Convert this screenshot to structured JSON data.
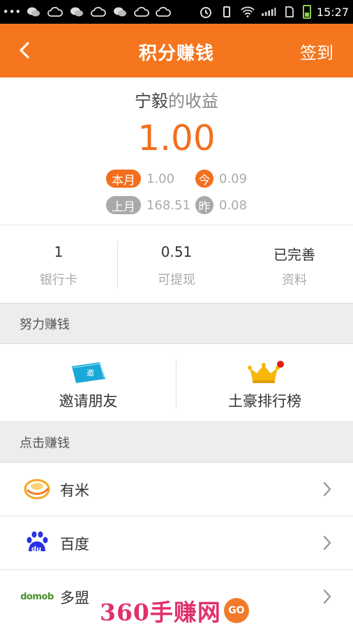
{
  "status_bar": {
    "time": "15:27",
    "left_icons": [
      "more-dots-icon",
      "wechat-icon",
      "cloud-icon",
      "wechat-icon",
      "cloud-icon",
      "wechat-icon",
      "cloud-icon",
      "cloud-icon"
    ],
    "right_icons": [
      "alarm-icon",
      "vibrate-icon",
      "wifi-icon",
      "signal-icon",
      "sim-icon",
      "battery-icon"
    ]
  },
  "header": {
    "title": "积分赚钱",
    "back_icon": "chevron-left-icon",
    "checkin_label": "签到"
  },
  "earnings": {
    "username": "宁毅",
    "title_suffix": "的收益",
    "total": "1.00",
    "this_month_label": "本月",
    "this_month_value": "1.00",
    "today_label": "今",
    "today_value": "0.09",
    "last_month_label": "上月",
    "last_month_value": "168.51",
    "yesterday_label": "昨",
    "yesterday_value": "0.08",
    "accent_color": "#f26f1e",
    "muted_badge_color": "#a9a9a9"
  },
  "summary": [
    {
      "value": "1",
      "label": "银行卡"
    },
    {
      "value": "0.51",
      "label": "可提现"
    },
    {
      "value": "已完善",
      "label": "资料"
    }
  ],
  "section_effort": {
    "title": "努力赚钱"
  },
  "effort_items": [
    {
      "label": "邀请朋友",
      "icon": "invite-card-icon",
      "icon_text": "邀"
    },
    {
      "label": "土豪排行榜",
      "icon": "crown-icon"
    }
  ],
  "section_click": {
    "title": "点击赚钱"
  },
  "click_items": [
    {
      "label": "有米",
      "icon": "youmi-icon"
    },
    {
      "label": "百度",
      "icon": "baidu-paw-icon",
      "icon_text": "du"
    },
    {
      "label": "多盟",
      "icon": "domob-logo-icon",
      "icon_text": "domob"
    }
  ],
  "watermark": {
    "text": "360手赚网",
    "badge": "GO"
  },
  "colors": {
    "header_bg": "#f5761e",
    "section_bg": "#ededed"
  }
}
